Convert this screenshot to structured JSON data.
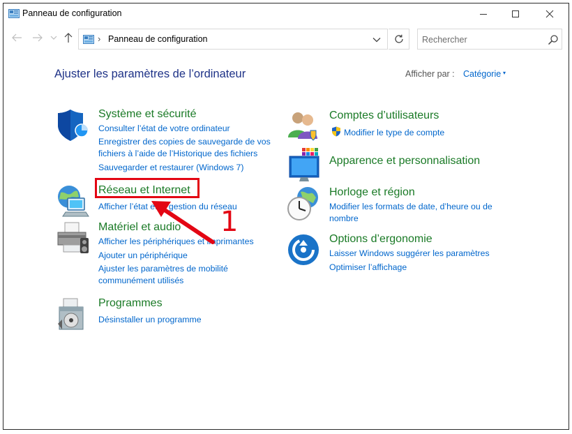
{
  "window": {
    "title": "Panneau de configuration",
    "controls": {
      "minimize": "minimize",
      "maximize": "maximize",
      "close": "close"
    }
  },
  "nav": {
    "breadcrumb_sep": "›",
    "address": "Panneau de configuration",
    "search_placeholder": "Rechercher"
  },
  "main": {
    "heading": "Ajuster les paramètres de l’ordinateur",
    "view_by_label": "Afficher par :",
    "view_by_value": "Catégorie",
    "view_by_caret": "▾"
  },
  "categories_left": [
    {
      "title": "Système et sécurité",
      "icon": "shield-icon",
      "links": [
        "Consulter l’état de votre ordinateur",
        "Enregistrer des copies de sauvegarde de vos",
        "fichiers à l’aide de l’Historique des fichiers",
        "Sauvegarder et restaurer (Windows 7)"
      ]
    },
    {
      "title": "Réseau et Internet",
      "icon": "network-icon",
      "links": [
        "Afficher l’état et la gestion du réseau"
      ]
    },
    {
      "title": "Matériel et audio",
      "icon": "printer-icon",
      "links": [
        "Afficher les périphériques et imprimantes",
        "Ajouter un périphérique",
        "Ajuster les paramètres de mobilité",
        "communément utilisés"
      ]
    },
    {
      "title": "Programmes",
      "icon": "programs-icon",
      "links": [
        "Désinstaller un programme"
      ]
    }
  ],
  "categories_right": [
    {
      "title": "Comptes d’utilisateurs",
      "icon": "users-icon",
      "links": [
        "Modifier le type de compte"
      ]
    },
    {
      "title": "Apparence et personnalisation",
      "icon": "appearance-icon",
      "links": []
    },
    {
      "title": "Horloge et région",
      "icon": "clock-icon",
      "links": [
        "Modifier les formats de date, d’heure ou de",
        "nombre"
      ]
    },
    {
      "title": "Options d’ergonomie",
      "icon": "ease-of-access-icon",
      "links": [
        "Laisser Windows suggérer les paramètres",
        "Optimiser l’affichage"
      ]
    }
  ],
  "annotation": {
    "step": "1",
    "color": "#e30613"
  },
  "colors": {
    "title_green": "#1a7a26",
    "link_blue": "#0066cc",
    "heading_blue": "#1e3287"
  }
}
